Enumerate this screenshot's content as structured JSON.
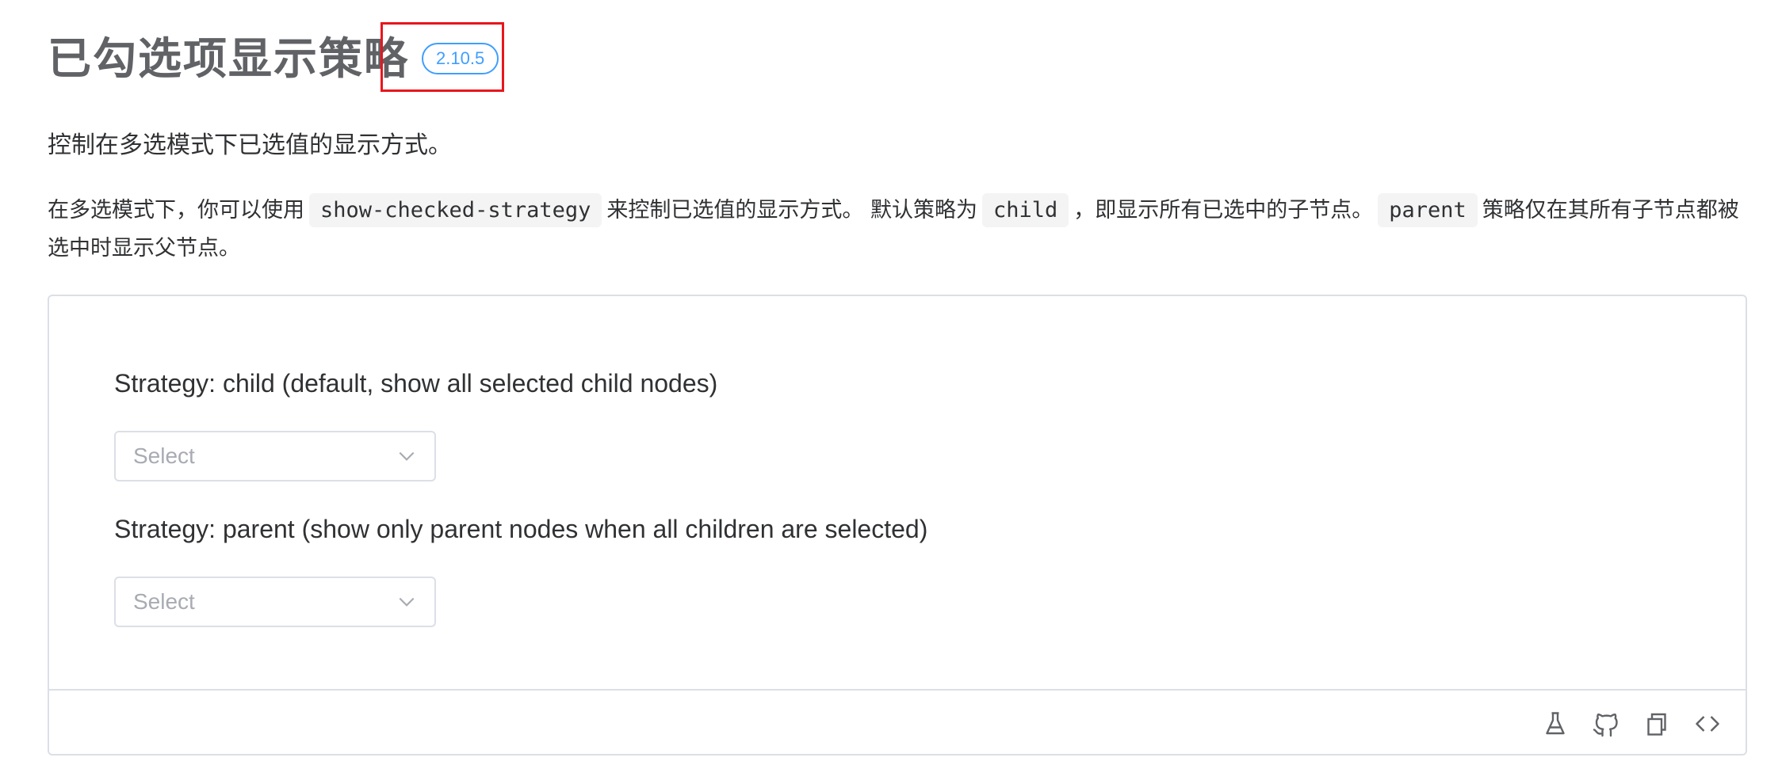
{
  "header": {
    "title": "已勾选项显示策略",
    "version_badge": "2.10.5"
  },
  "subtitle": "控制在多选模式下已选值的显示方式。",
  "description": {
    "part1": "在多选模式下，你可以使用",
    "code1": "show-checked-strategy",
    "part2": "来控制已选值的显示方式。 默认策略为",
    "code2": "child",
    "part3": "，即显示所有已选中的子节点。",
    "code3": "parent",
    "part4": "策略仅在其所有子节点都被选中时显示父节点。"
  },
  "demo": {
    "strategy_child_label": "Strategy: child (default, show all selected child nodes)",
    "strategy_child_select_placeholder": "Select",
    "strategy_parent_label": "Strategy: parent (show only parent nodes when all children are selected)",
    "strategy_parent_select_placeholder": "Select",
    "footer_icons": [
      "flask-icon",
      "github-icon",
      "copy-icon",
      "code-icon"
    ]
  },
  "colors": {
    "accent": "#409eff",
    "highlight": "#e8161d",
    "border": "#dcdfe6",
    "placeholder": "#a8abb2"
  }
}
